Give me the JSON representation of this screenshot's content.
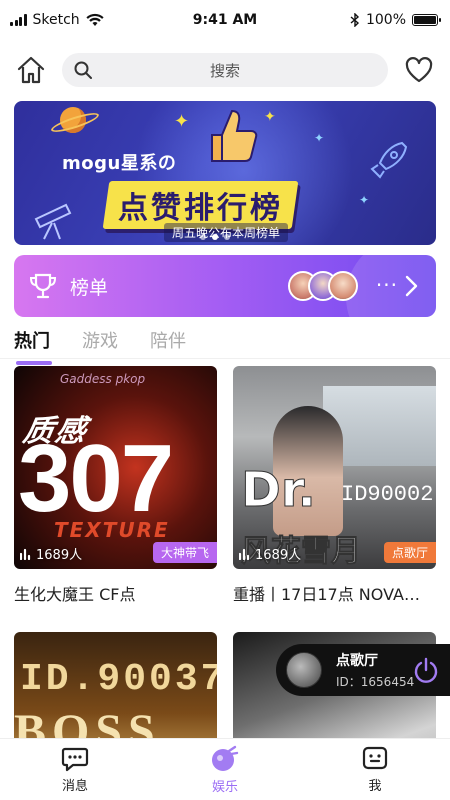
{
  "status_bar": {
    "carrier": "Sketch",
    "time": "9:41 AM",
    "battery": "100%"
  },
  "header": {
    "search_placeholder": "搜索"
  },
  "banner": {
    "brand": "mogu星系の",
    "title": "点赞排行榜",
    "subtitle": "周五晚公布本周榜单"
  },
  "ranking": {
    "label": "榜单",
    "more": "···"
  },
  "tabs": [
    {
      "label": "热门",
      "active": true
    },
    {
      "label": "游戏",
      "active": false
    },
    {
      "label": "陪伴",
      "active": false
    }
  ],
  "cards": [
    {
      "title": "生化大魔王 CF点",
      "viewers": "1689人",
      "tag": "大神带飞",
      "tag_color": "#b767f0",
      "cover": {
        "top": "Gaddess pkop",
        "script": "质感",
        "number": "307",
        "bottom": "TEXTURE"
      }
    },
    {
      "title": "重播丨17日17点 NOVA…",
      "viewers": "1689人",
      "tag": "点歌厅",
      "tag_color": "#f0793a",
      "cover": {
        "line1": "Dr.",
        "line2": "ID90002",
        "line3": "风花雪月"
      }
    },
    {
      "title": "",
      "viewers": "",
      "tag": "",
      "cover": {
        "line1": "ID.90037",
        "line2": "BOSS"
      }
    },
    {
      "title": "",
      "viewers": "",
      "tag": "",
      "cover": {}
    }
  ],
  "mini_player": {
    "name": "点歌厅",
    "room_id": "ID：1656454"
  },
  "bottom_nav": [
    {
      "label": "消息",
      "icon": "message-icon",
      "active": false
    },
    {
      "label": "娱乐",
      "icon": "entertainment-icon",
      "active": true
    },
    {
      "label": "我",
      "icon": "profile-face-icon",
      "active": false
    }
  ],
  "colors": {
    "accent": "#9b6df5",
    "ranking_gradient_start": "#d777f0",
    "ranking_gradient_end": "#6f49f0",
    "banner_bg": "#3b41b8",
    "banner_title_bg": "#f7e24a"
  }
}
